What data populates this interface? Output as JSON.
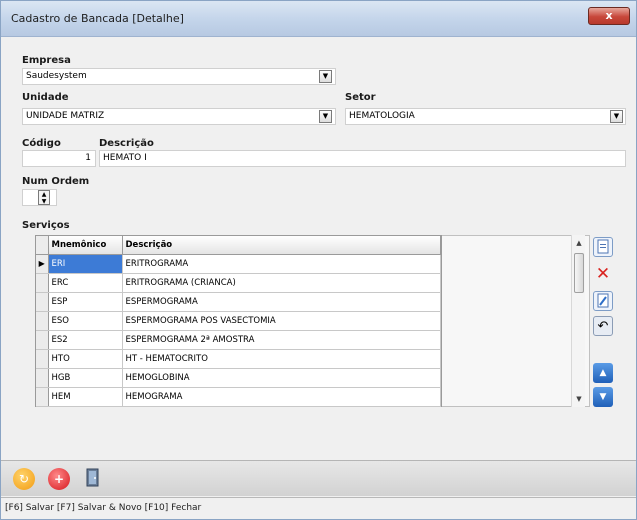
{
  "window": {
    "title": "Cadastro de Bancada [Detalhe]",
    "close_label": "x"
  },
  "form": {
    "empresa_label": "Empresa",
    "empresa_value": "Saudesystem",
    "unidade_label": "Unidade",
    "unidade_value": "UNIDADE MATRIZ",
    "setor_label": "Setor",
    "setor_value": "HEMATOLOGIA",
    "codigo_label": "Código",
    "codigo_value": "1",
    "descricao_label": "Descrição",
    "descricao_value": "HEMATO I",
    "num_ordem_label": "Num Ordem",
    "servicos_label": "Serviços"
  },
  "grid": {
    "columns": [
      "Mnemônico",
      "Descrição"
    ],
    "rows": [
      {
        "mnemonico": "ERI",
        "descricao": "ERITROGRAMA",
        "selected": true
      },
      {
        "mnemonico": "ERC",
        "descricao": "ERITROGRAMA (CRIANCA)"
      },
      {
        "mnemonico": "ESP",
        "descricao": "ESPERMOGRAMA"
      },
      {
        "mnemonico": "ESO",
        "descricao": "ESPERMOGRAMA POS VASECTOMIA"
      },
      {
        "mnemonico": "ES2",
        "descricao": "ESPERMOGRAMA 2ª AMOSTRA"
      },
      {
        "mnemonico": "HTO",
        "descricao": "HT - HEMATOCRITO"
      },
      {
        "mnemonico": "HGB",
        "descricao": "HEMOGLOBINA"
      },
      {
        "mnemonico": "HEM",
        "descricao": "HEMOGRAMA"
      }
    ]
  },
  "side_buttons": [
    "new-document-icon",
    "delete-icon",
    "edit-document-icon",
    "undo-icon",
    "move-up-icon",
    "move-down-icon"
  ],
  "toolbar": [
    "save-icon",
    "save-new-icon",
    "exit-icon"
  ],
  "status": {
    "text": "[F6] Salvar [F7] Salvar & Novo [F10] Fechar"
  },
  "colors": {
    "selection": "#3d7bd6",
    "delete": "#d9231f",
    "accent": "#2f6fc8"
  }
}
